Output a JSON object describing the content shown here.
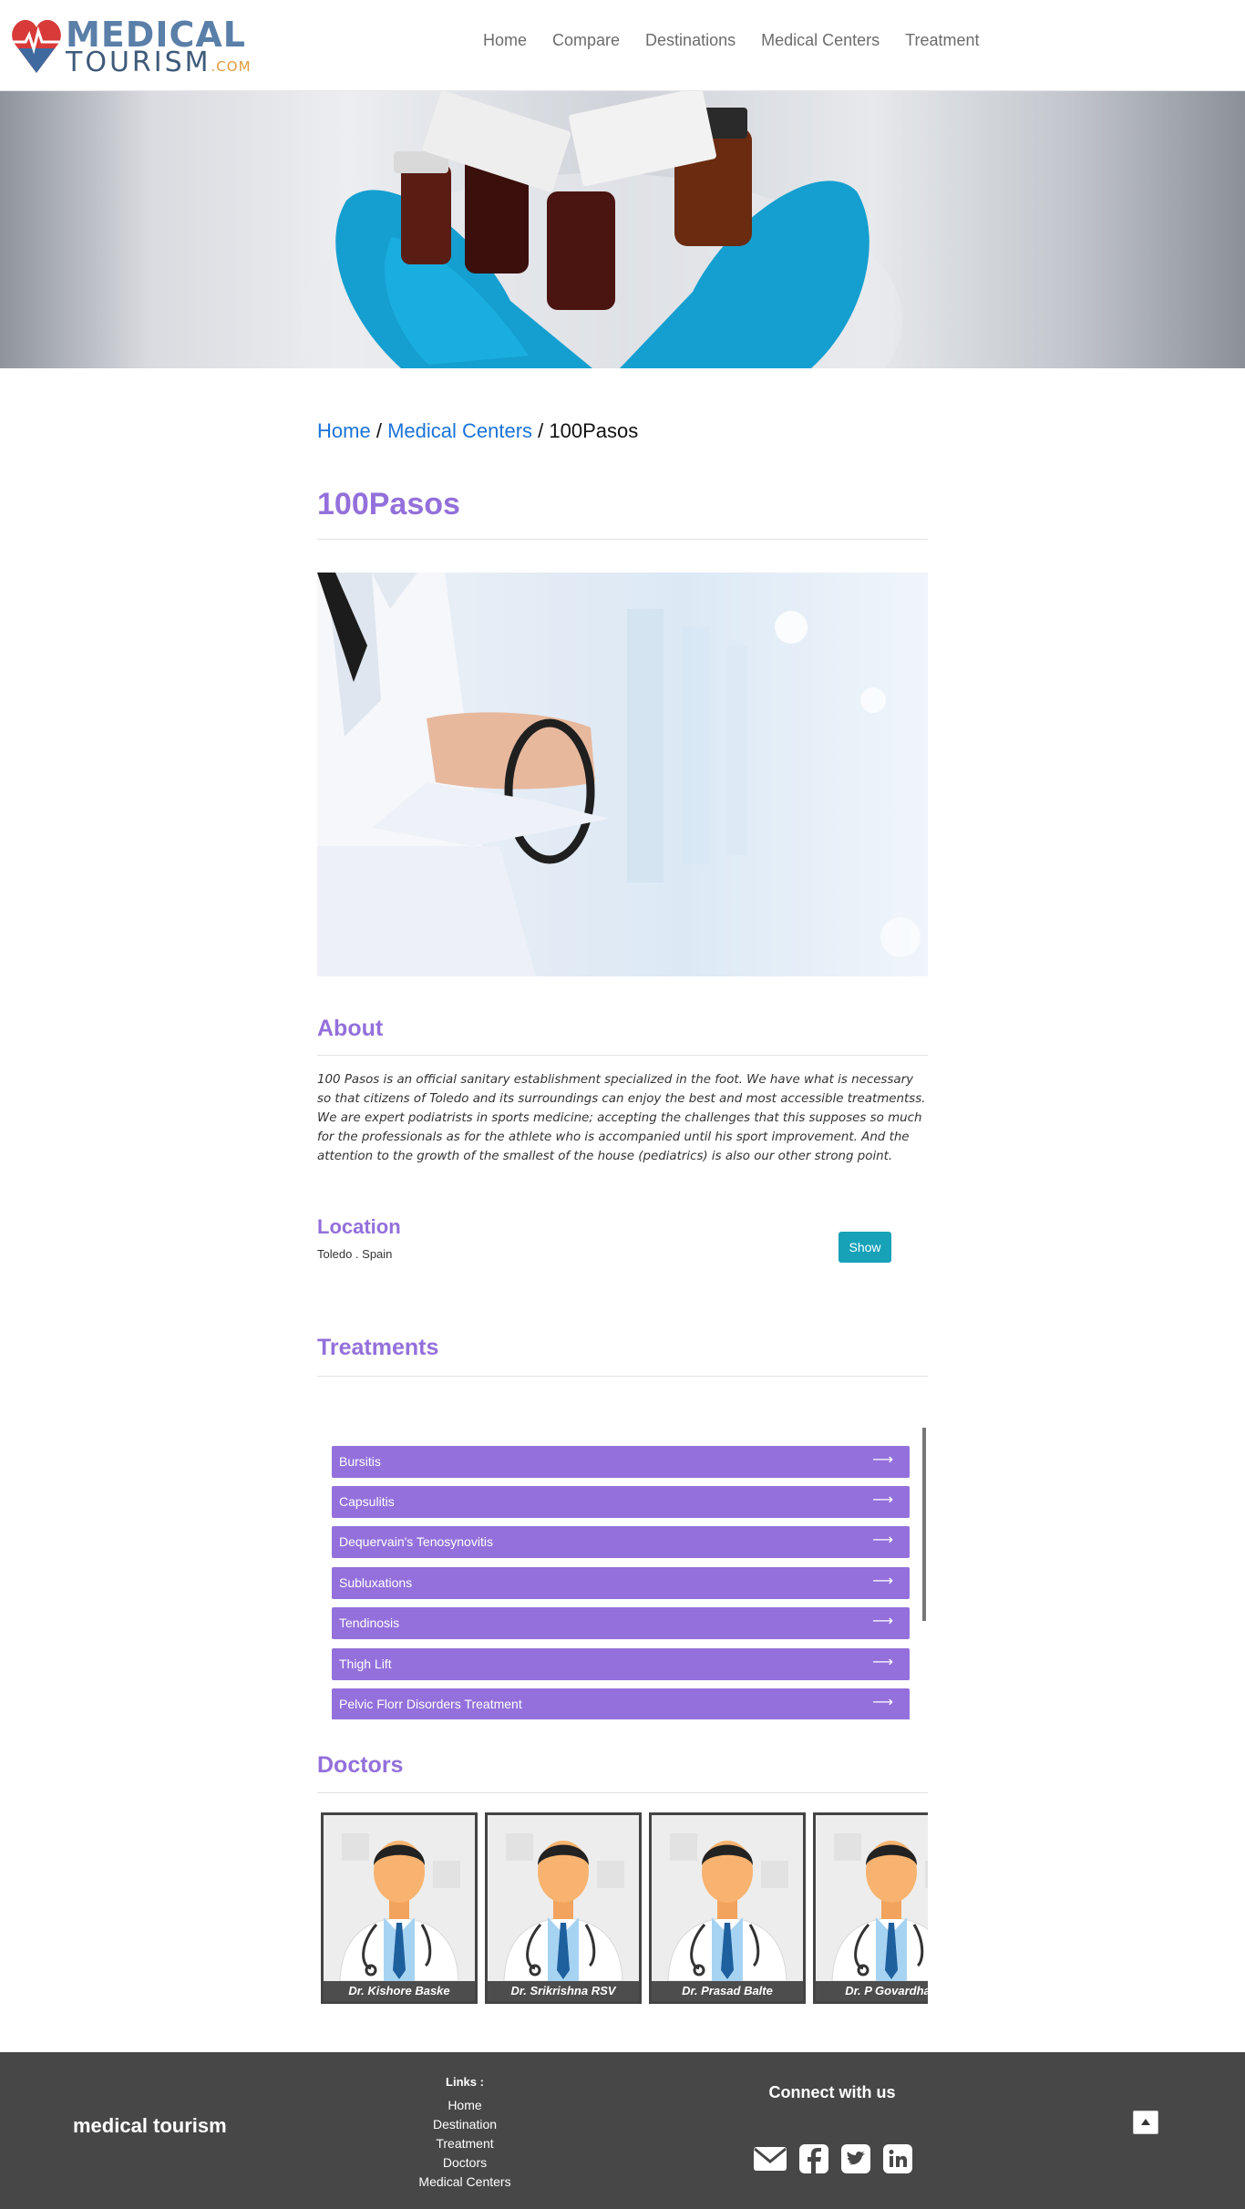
{
  "header": {
    "logo": {
      "top": "MEDICAL",
      "bottom": "TOURISM",
      "suffix": ".COM"
    },
    "nav": [
      "Home",
      "Compare",
      "Destinations",
      "Medical Centers",
      "Treatment"
    ]
  },
  "breadcrumb": {
    "home": "Home",
    "sep": "/",
    "section": "Medical Centers",
    "current": "100Pasos"
  },
  "center": {
    "name": "100Pasos",
    "about_title": "About",
    "about_text": "100 Pasos is an official sanitary establishment specialized in the foot. We have what is necessary so that citizens of Toledo and its surroundings can enjoy the best and most accessible treatmentss.  We are expert podiatrists in sports medicine; accepting the challenges that this supposes so much for the professionals as for the athlete who is accompanied until his sport improvement. And the attention to the growth of the smallest of the house (pediatrics) is also our other strong point.",
    "location_title": "Location",
    "location_value": "Toledo . Spain",
    "show_label": "Show"
  },
  "treatments": {
    "title": "Treatments",
    "items": [
      "Bursitis",
      "Capsulitis",
      "Dequervain's Tenosynovitis",
      "Subluxations",
      "Tendinosis",
      "Thigh Lift",
      "Pelvic Florr Disorders Treatment"
    ],
    "arrow": "⟶"
  },
  "doctors": {
    "title": "Doctors",
    "items": [
      "Dr. Kishore Baske",
      "Dr. Srikrishna RSV",
      "Dr. Prasad Balte",
      "Dr. P Govardhan"
    ]
  },
  "footer": {
    "brand": "medical tourism",
    "links_title": "Links :",
    "links": [
      "Home",
      "Destination",
      "Treatment",
      "Doctors",
      "Medical Centers"
    ],
    "connect": "Connect with us",
    "social_icons": [
      "envelope-icon",
      "facebook-icon",
      "twitter-icon",
      "linkedin-icon"
    ]
  },
  "colors": {
    "accent": "#9370db",
    "link": "#1a73d9",
    "button": "#17a2b8",
    "footer": "#474747"
  }
}
